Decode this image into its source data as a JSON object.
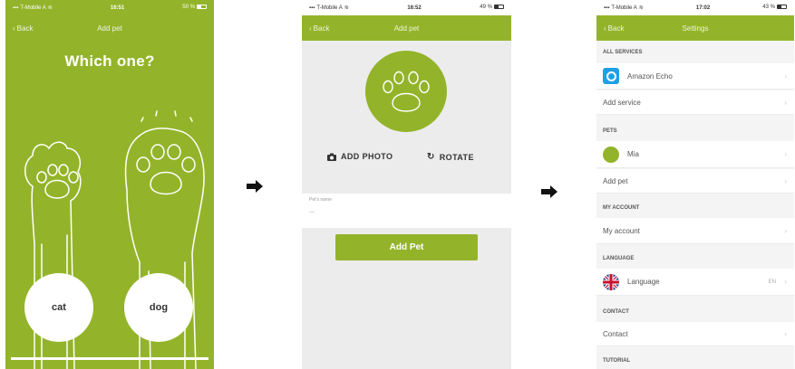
{
  "screen1": {
    "status": {
      "carrier": "T-Mobile A",
      "time": "16:51",
      "battery": "50 %"
    },
    "nav": {
      "back": "Back",
      "title": "Add pet"
    },
    "heading": "Which one?",
    "options": {
      "cat": "cat",
      "dog": "dog"
    }
  },
  "screen2": {
    "status": {
      "carrier": "T-Mobile A",
      "time": "16:52",
      "battery": "49 %"
    },
    "nav": {
      "back": "Back",
      "title": "Add pet"
    },
    "add_photo": "ADD PHOTO",
    "rotate": "ROTATE",
    "name_label": "Pet's name",
    "name_placeholder": "...",
    "add_pet_button": "Add Pet"
  },
  "screen3": {
    "status": {
      "carrier": "T-Mobile A",
      "time": "17:02",
      "battery": "43 %"
    },
    "nav": {
      "back": "Back",
      "title": "Settings"
    },
    "sections": {
      "all_services": "ALL SERVICES",
      "pets": "PETS",
      "my_account": "MY ACCOUNT",
      "language": "LANGUAGE",
      "contact": "CONTACT",
      "tutorial": "TUTORIAL"
    },
    "rows": {
      "amazon_echo": "Amazon Echo",
      "add_service": "Add service",
      "pet_mia": "Mia",
      "add_pet": "Add pet",
      "my_account": "My account",
      "language": "Language",
      "language_value": "EN",
      "contact": "Contact"
    }
  },
  "icons": {
    "back": "chevron-left-icon",
    "camera": "camera-icon",
    "rotate": "rotate-icon",
    "arrow": "arrow-right-icon",
    "echo": "amazon-echo-icon",
    "flag": "uk-flag-icon",
    "chevron": "chevron-right-icon"
  },
  "colors": {
    "accent": "#93b42a",
    "echo_blue": "#1da1e3",
    "background": "#ececec"
  }
}
